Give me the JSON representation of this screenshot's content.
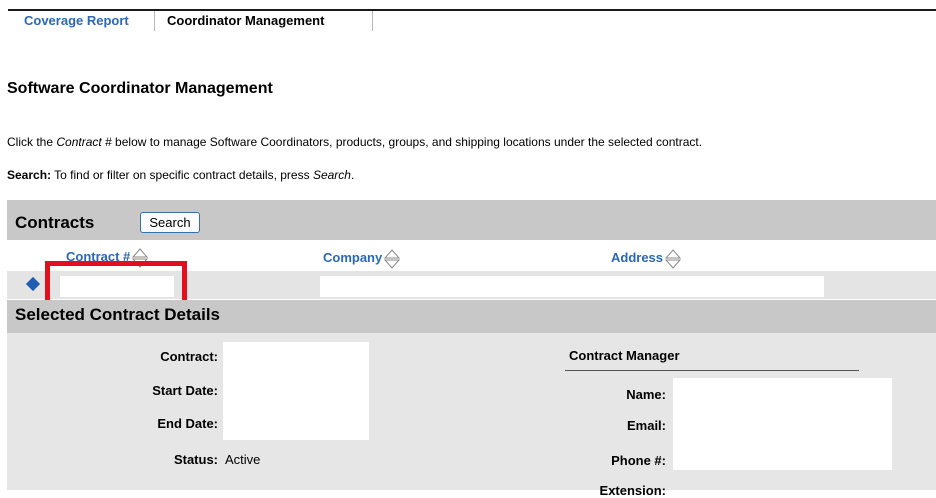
{
  "tabs": [
    {
      "label": "Coverage Report",
      "active": false
    },
    {
      "label": "Coordinator Management",
      "active": true
    }
  ],
  "page_title": "Software Coordinator Management",
  "description": {
    "prefix": "Click the ",
    "emphasis": "Contract #",
    "suffix": " below to manage Software Coordinators, products, groups, and shipping locations under the selected contract."
  },
  "search_help": {
    "label": "Search:",
    "text": " To find or filter on specific contract details, press ",
    "emphasis": "Search",
    "end": "."
  },
  "contracts": {
    "title": "Contracts",
    "search_button": "Search",
    "columns": [
      "Contract #",
      "Company",
      "Address"
    ],
    "rows": [
      {
        "contract": "",
        "company": "",
        "address": ""
      }
    ]
  },
  "details": {
    "title": "Selected Contract Details",
    "contract_label": "Contract:",
    "start_label": "Start Date:",
    "end_label": "End Date:",
    "status_label": "Status:",
    "status_value": "Active",
    "manager": {
      "title": "Contract Manager",
      "name_label": "Name:",
      "email_label": "Email:",
      "phone_label": "Phone #:",
      "ext_label": "Extension:"
    }
  },
  "colors": {
    "link_blue": "#2a68b6",
    "header_gray": "#c8c8c8",
    "highlight_red": "#e30f1b",
    "selected_marker": "#1f5db0"
  }
}
